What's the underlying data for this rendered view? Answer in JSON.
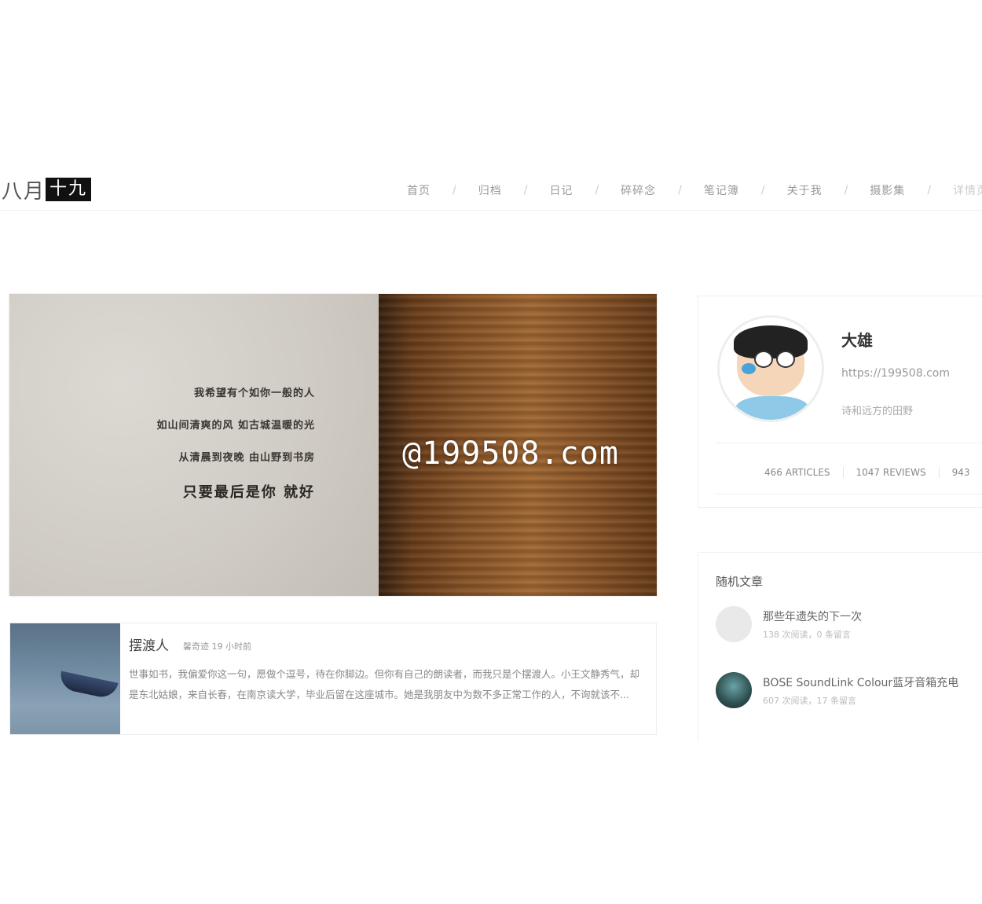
{
  "header": {
    "logo_part1": "八月",
    "logo_part2": "十九",
    "nav": [
      "首页",
      "归档",
      "日记",
      "碎碎念",
      "笔记簿",
      "关于我",
      "摄影集"
    ],
    "nav_tail": "详情页"
  },
  "banner": {
    "poem_lines": [
      "我希望有个如你一般的人",
      "如山间清爽的风  如古城温暖的光",
      "从清晨到夜晚  由山野到书房"
    ],
    "poem_highlight": "只要最后是你  就好",
    "watermark": "@199508.com"
  },
  "post": {
    "title": "摆渡人",
    "meta": "馨奇迹 19 小时前",
    "excerpt": "世事如书，我偏爱你这一句，愿做个逗号，待在你脚边。但你有自己的朗读者，而我只是个摆渡人。小王文静秀气，却是东北姑娘，来自长春，在南京读大学，毕业后留在这座城市。她是我朋友中为数不多正常工作的人，不询就该不..."
  },
  "profile": {
    "name": "大雄",
    "url": "https://199508.com",
    "desc": "诗和远方的田野",
    "stats": [
      "466 ARTICLES",
      "1047 REVIEWS",
      "943"
    ]
  },
  "random": {
    "title": "随机文章",
    "items": [
      {
        "title": "那些年遗失的下一次",
        "meta": "138 次阅读，0 条留言"
      },
      {
        "title": "BOSE SoundLink Colour蓝牙音箱充电",
        "meta": "607 次阅读，17 条留言"
      }
    ]
  }
}
